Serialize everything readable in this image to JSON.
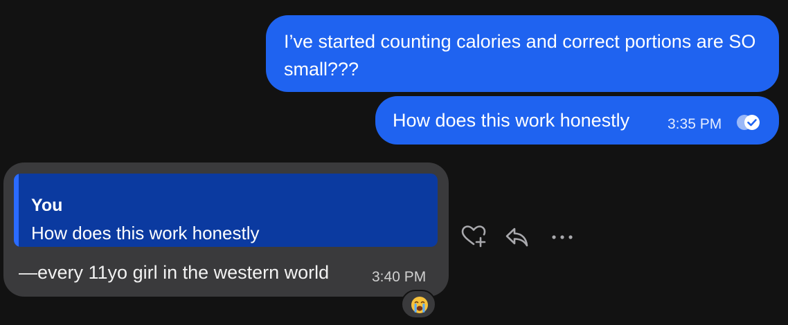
{
  "messages": {
    "outgoing_1": {
      "text": "I’ve started counting calories and correct portions are SO small???"
    },
    "outgoing_2": {
      "text": "How does this work honestly",
      "time": "3:35 PM",
      "status_icon": "read-receipt-icon"
    },
    "incoming_1": {
      "quote": {
        "author": "You",
        "text": "How does this work honestly"
      },
      "text": "—every 11yo girl in the western world",
      "time": "3:40 PM",
      "reaction": "😭"
    }
  },
  "actions": {
    "icons": [
      "heart-plus-icon",
      "reply-icon",
      "more-icon"
    ]
  },
  "colors": {
    "background": "#121212",
    "outgoing_bubble": "#1f63f0",
    "incoming_bubble": "#3a3a3c",
    "quote_background": "#0b3aa0",
    "quote_accent": "#2a6bff"
  }
}
